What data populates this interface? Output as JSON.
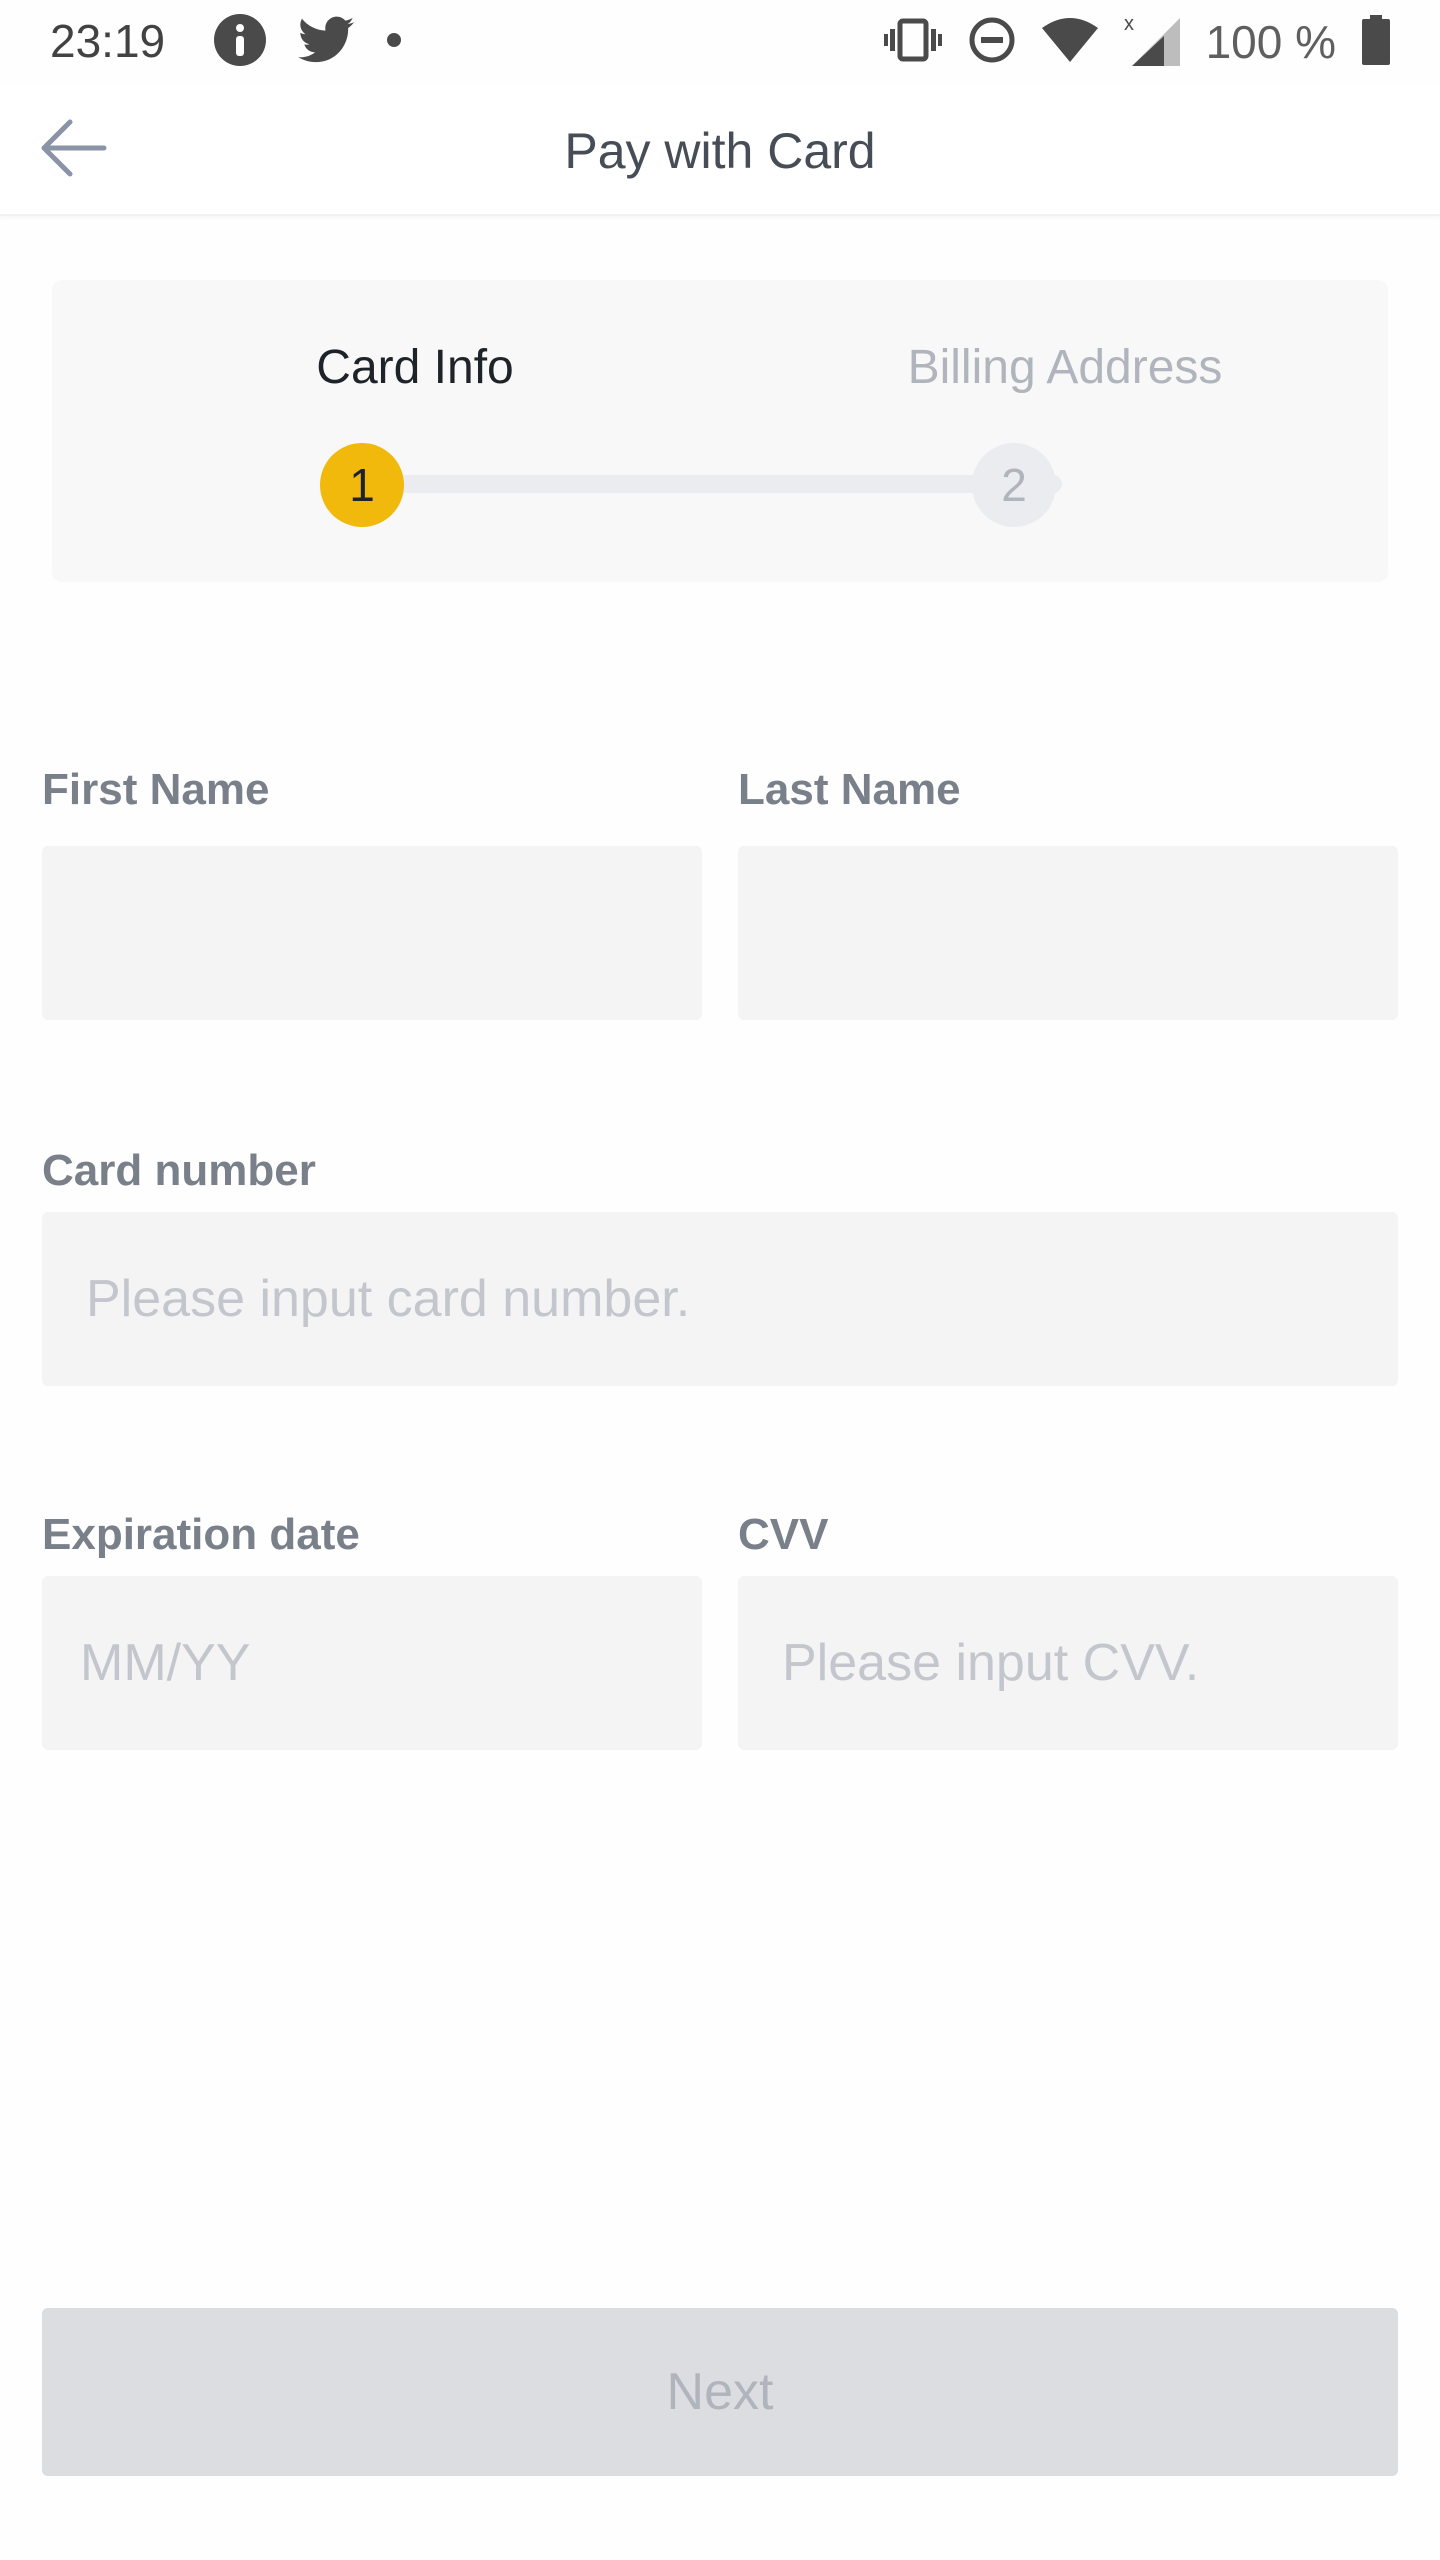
{
  "status_bar": {
    "time": "23:19",
    "battery": "100 %",
    "icons": [
      "info-notification-icon",
      "twitter-icon",
      "dot-icon",
      "vibrate-icon",
      "do-not-disturb-icon",
      "wifi-icon",
      "signal-icon",
      "battery-icon"
    ]
  },
  "app_bar": {
    "title": "Pay with Card",
    "back_icon": "back-arrow-icon"
  },
  "stepper": {
    "steps": [
      {
        "label": "Card Info",
        "number": "1",
        "state": "active"
      },
      {
        "label": "Billing Address",
        "number": "2",
        "state": "inactive"
      }
    ],
    "accent_color": "#f0b90b"
  },
  "form": {
    "first_name": {
      "label": "First Name",
      "value": "",
      "placeholder": ""
    },
    "last_name": {
      "label": "Last Name",
      "value": "",
      "placeholder": ""
    },
    "card_number": {
      "label": "Card number",
      "value": "",
      "placeholder": "Please input card number."
    },
    "expiration": {
      "label": "Expiration date",
      "value": "",
      "placeholder": "MM/YY"
    },
    "cvv": {
      "label": "CVV",
      "value": "",
      "placeholder": "Please input CVV."
    }
  },
  "next_button": {
    "label": "Next",
    "enabled": false
  }
}
